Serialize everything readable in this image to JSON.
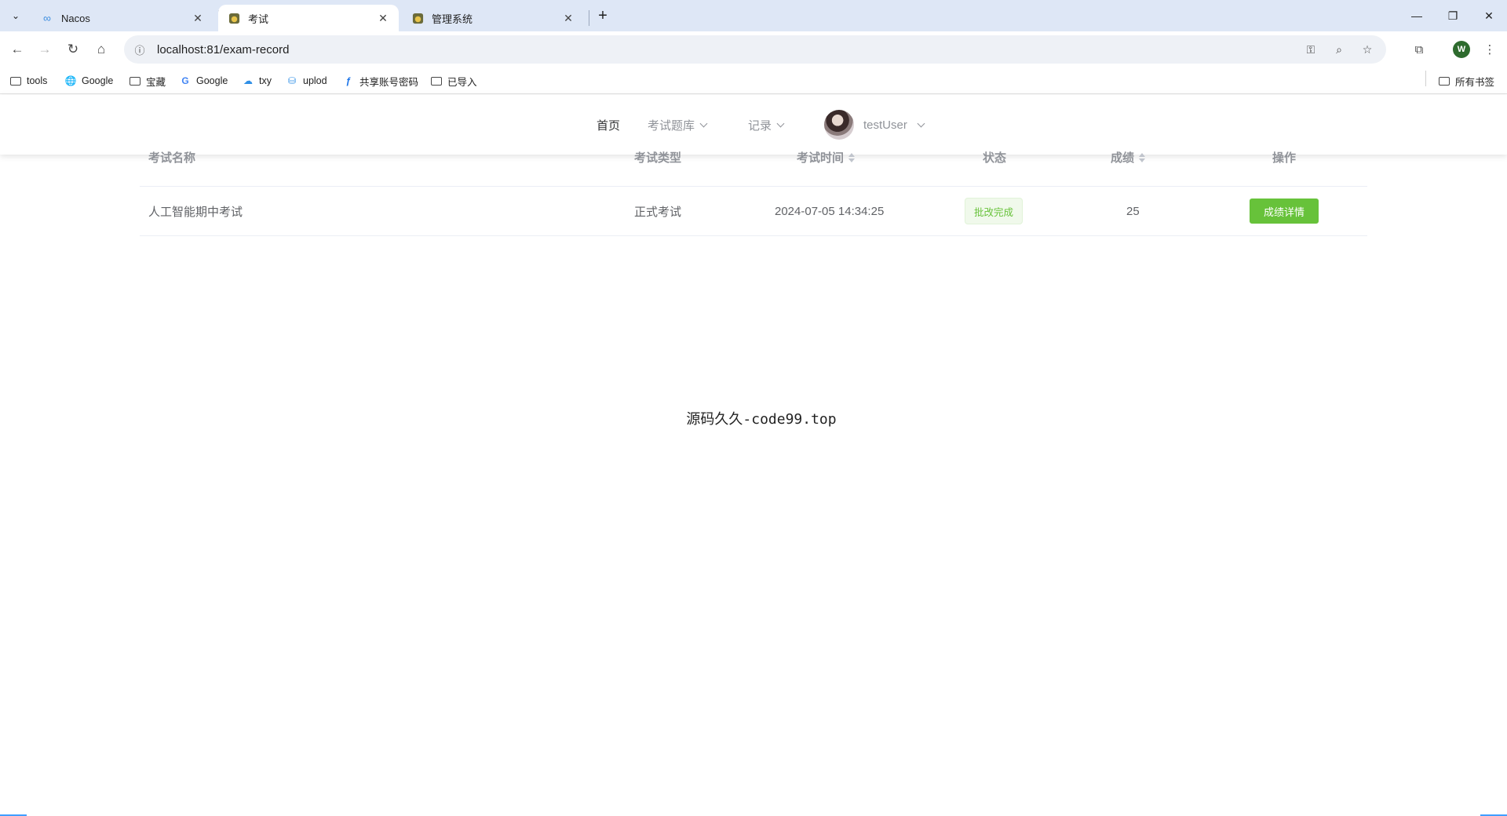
{
  "browser": {
    "tabs": [
      {
        "title": "Nacos",
        "icon": "infinity-icon",
        "active": false
      },
      {
        "title": "考试",
        "icon": "app-favicon",
        "active": true
      },
      {
        "title": "管理系统",
        "icon": "app-favicon",
        "active": false
      }
    ],
    "url": "localhost:81/exam-record",
    "profile_initial": "W",
    "bookmarks": [
      {
        "label": "tools",
        "icon": "folder-icon"
      },
      {
        "label": "Google",
        "icon": "globe-icon"
      },
      {
        "label": "宝藏",
        "icon": "folder-icon"
      },
      {
        "label": "Google",
        "icon": "google-icon"
      },
      {
        "label": "txy",
        "icon": "cloud-icon"
      },
      {
        "label": "uplod",
        "icon": "upload-icon"
      },
      {
        "label": "共享账号密码",
        "icon": "share-icon"
      },
      {
        "label": "已导入",
        "icon": "folder-icon"
      }
    ],
    "all_bookmarks_label": "所有书签"
  },
  "nav": {
    "home": "首页",
    "question_bank": "考试题库",
    "records": "记录",
    "username": "testUser"
  },
  "table": {
    "columns": [
      "考试名称",
      "考试类型",
      "考试时间",
      "状态",
      "成绩",
      "操作"
    ],
    "rows": [
      {
        "name": "人工智能期中考试",
        "type": "正式考试",
        "time": "2024-07-05 14:34:25",
        "status": "批改完成",
        "score": "25",
        "action": "成绩详情"
      }
    ]
  },
  "footer": {
    "watermark": "源码久久-code99.top"
  },
  "colors": {
    "success": "#67c23a",
    "tab_bar": "#dee7f6",
    "primary": "#409eff"
  }
}
